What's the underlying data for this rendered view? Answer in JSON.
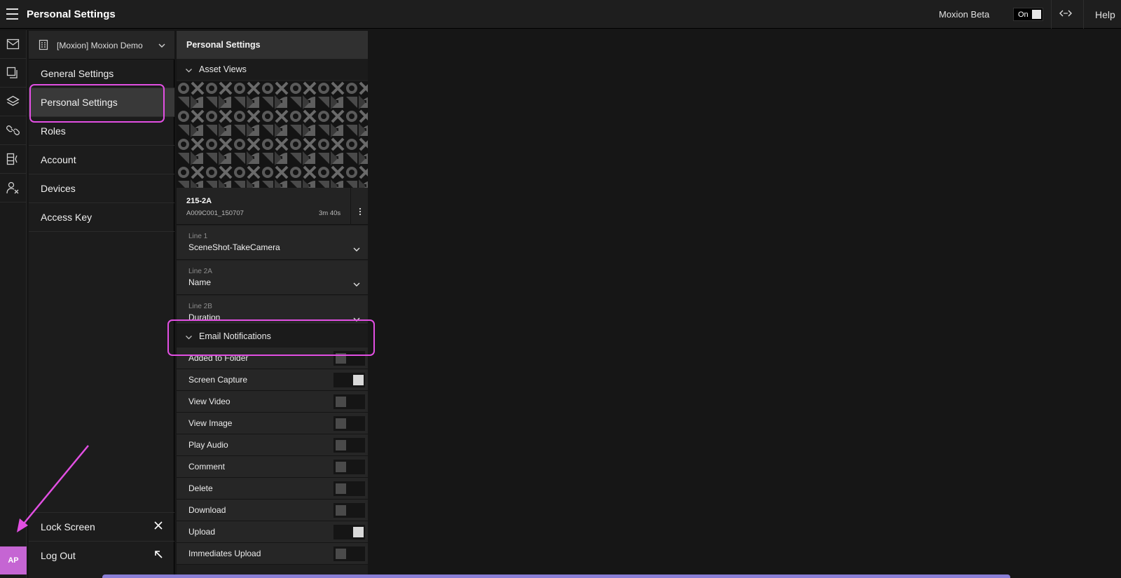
{
  "topbar": {
    "title": "Personal Settings",
    "beta_label": "Moxion Beta",
    "beta_toggle": "On",
    "help": "Help"
  },
  "rail": {
    "icons": [
      "inbox-icon",
      "copy-icon",
      "layers-icon",
      "link-icon",
      "storage-icon",
      "user-settings-icon"
    ],
    "avatar": "AP"
  },
  "menu": {
    "org": "[Moxion] Moxion Demo",
    "items": [
      {
        "label": "General Settings"
      },
      {
        "label": "Personal Settings",
        "active": true
      },
      {
        "label": "Roles"
      },
      {
        "label": "Account"
      },
      {
        "label": "Devices"
      },
      {
        "label": "Access Key"
      }
    ],
    "lock_screen": "Lock Screen",
    "log_out": "Log Out"
  },
  "panel": {
    "header": "Personal Settings",
    "asset_views": {
      "title": "Asset Views",
      "card": {
        "name": "215-2A",
        "clip": "A009C001_150707",
        "duration": "3m 40s"
      },
      "lines": [
        {
          "label": "Line 1",
          "value": "SceneShot-TakeCamera"
        },
        {
          "label": "Line 2A",
          "value": "Name"
        },
        {
          "label": "Line 2B",
          "value": "Duration"
        }
      ]
    },
    "email_notifications": {
      "title": "Email Notifications",
      "items": [
        {
          "label": "Added to Folder",
          "on": false
        },
        {
          "label": "Screen Capture",
          "on": true
        },
        {
          "label": "View Video",
          "on": false
        },
        {
          "label": "View Image",
          "on": false
        },
        {
          "label": "Play Audio",
          "on": false
        },
        {
          "label": "Comment",
          "on": false
        },
        {
          "label": "Delete",
          "on": false
        },
        {
          "label": "Download",
          "on": false
        },
        {
          "label": "Upload",
          "on": true
        },
        {
          "label": "Immediates Upload",
          "on": false
        }
      ]
    }
  },
  "colors": {
    "highlight": "#e24fe3",
    "avatar": "#c565d3",
    "background": "#161616"
  }
}
